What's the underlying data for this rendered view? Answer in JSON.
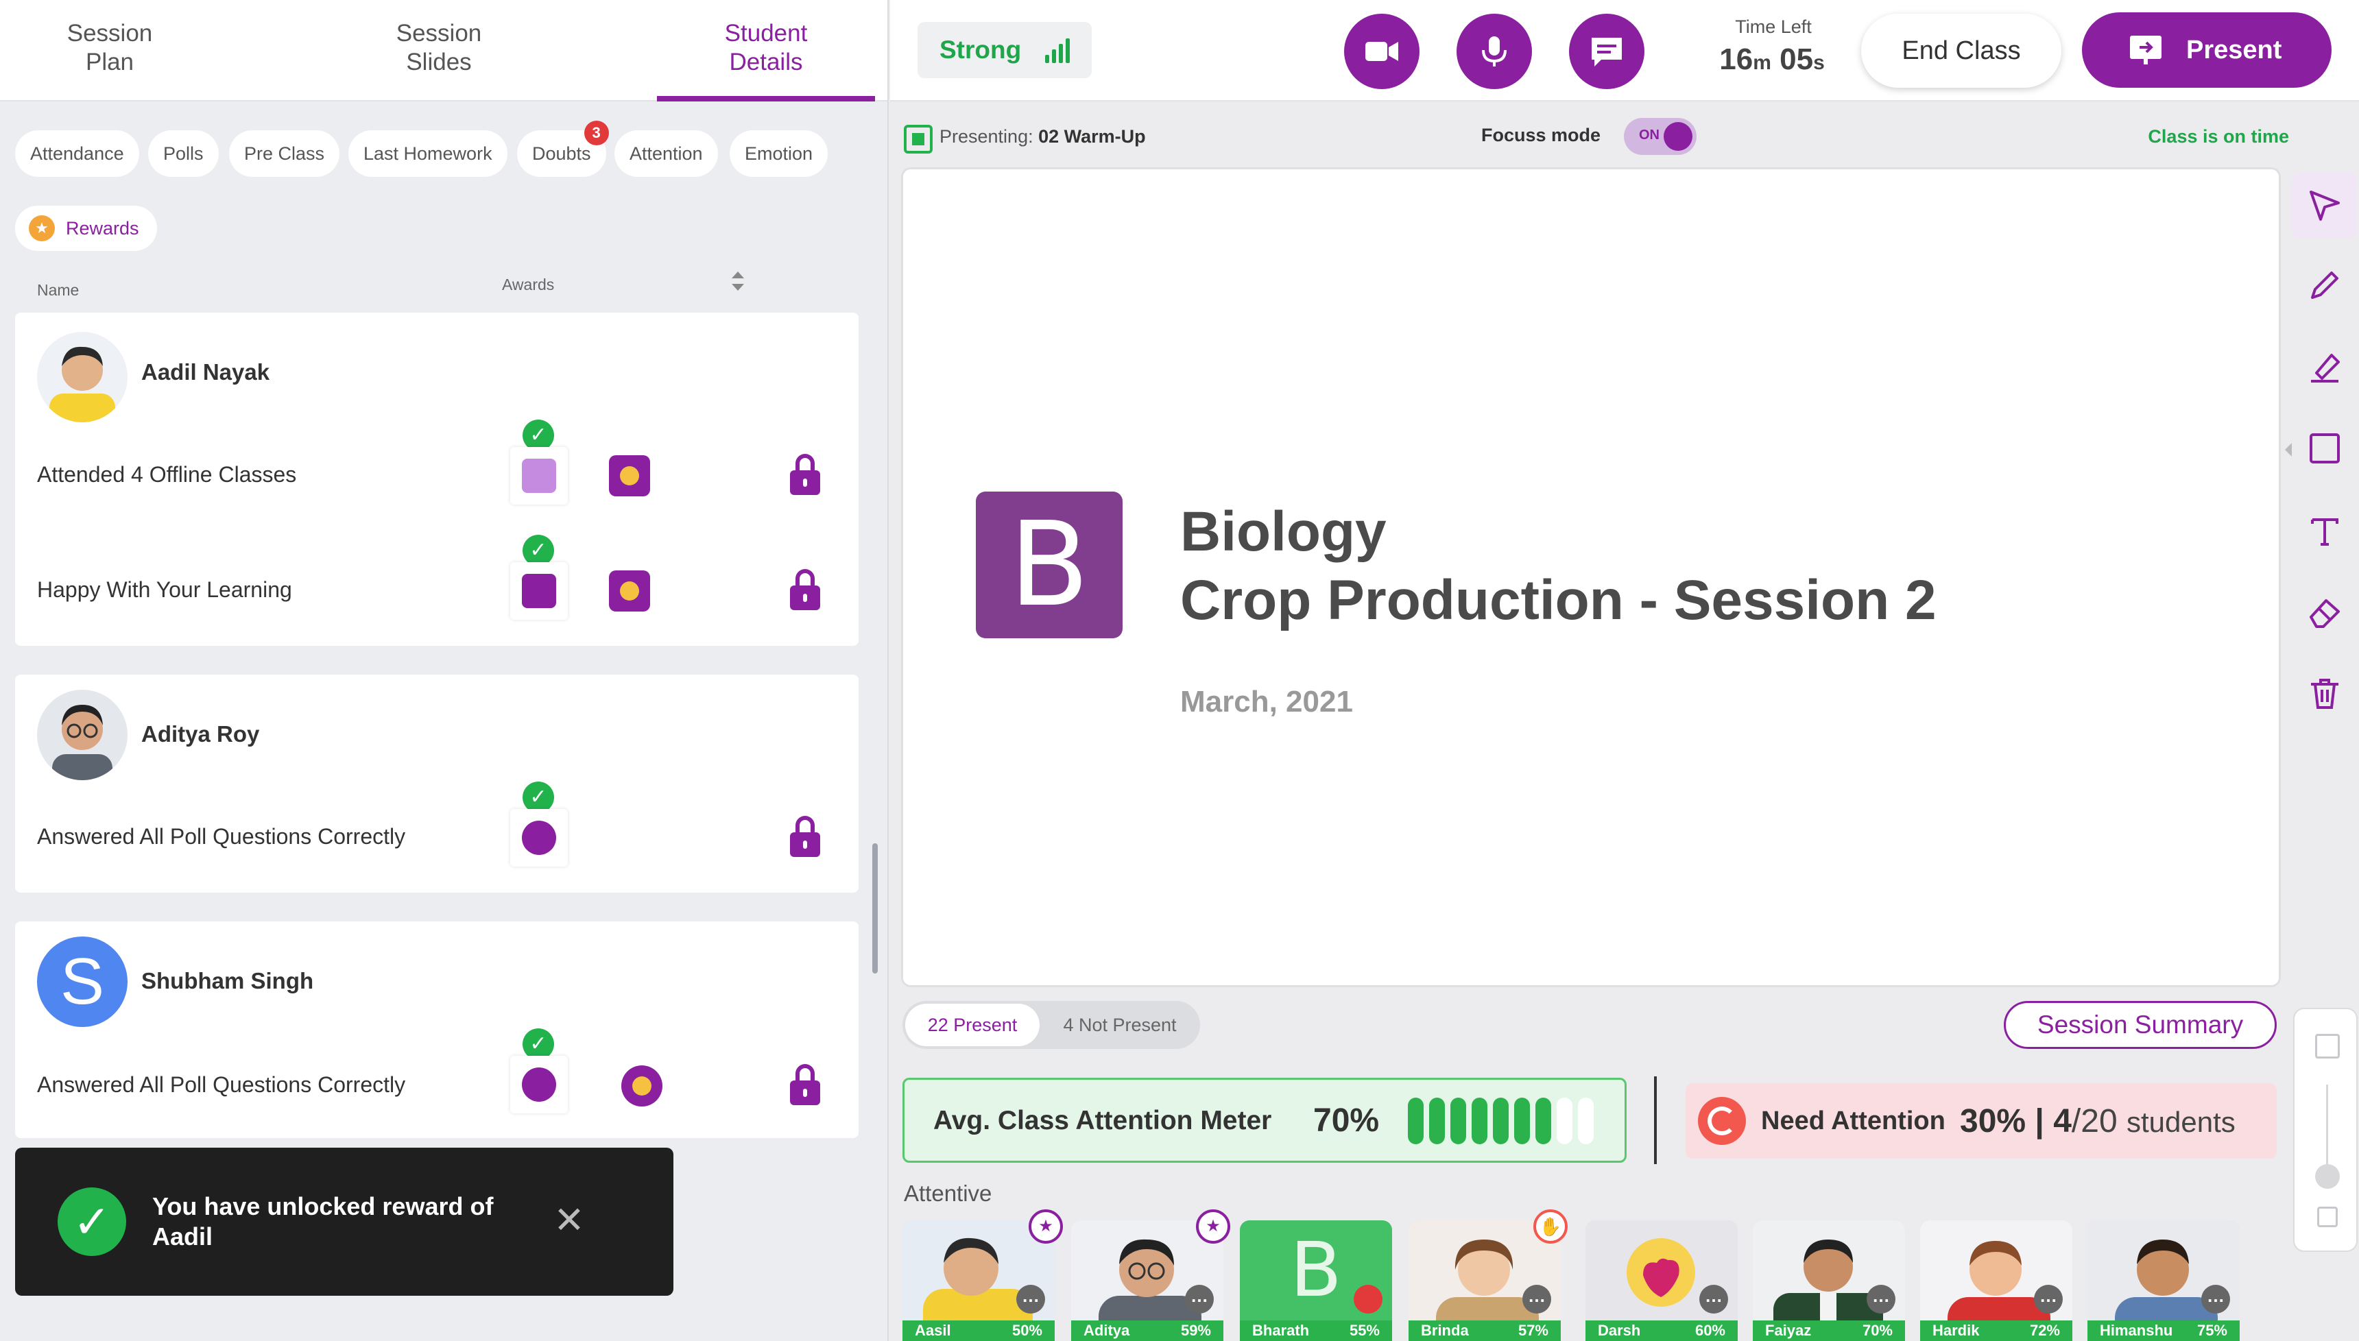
{
  "tabs": [
    {
      "label": "Session\nPlan"
    },
    {
      "label": "Session\nSlides"
    },
    {
      "label": "Student\nDetails",
      "active": true
    }
  ],
  "filters": [
    "Attendance",
    "Polls",
    "Pre Class",
    "Last Homework",
    "Doubts",
    "Attention",
    "Emotion"
  ],
  "doubts_badge": "3",
  "rewards_label": "Rewards",
  "columns": {
    "name": "Name",
    "awards": "Awards"
  },
  "students": [
    {
      "name": "Aadil Nayak",
      "awards": [
        "Attended 4 Offline Classes",
        "Happy With Your Learning"
      ]
    },
    {
      "name": "Aditya Roy",
      "awards": [
        "Answered All Poll Questions Correctly"
      ]
    },
    {
      "name": "Shubham Singh",
      "initial": "S",
      "awards": [
        "Answered All Poll Questions Correctly"
      ]
    }
  ],
  "toast": {
    "message": "You have unlocked reward of Aadil"
  },
  "topbar": {
    "network": "Strong",
    "time_left_label": "Time Left",
    "time_left_minutes": "16",
    "time_left_minutes_unit": "m",
    "time_left_seconds": "05",
    "time_left_seconds_unit": "s",
    "end_class": "End Class",
    "present": "Present"
  },
  "status": {
    "presenting_label": "Presenting:",
    "presenting_value": "02 Warm-Up",
    "focus_label": "Focuss mode",
    "focus_state": "ON",
    "class_status": "Class is on time"
  },
  "slide": {
    "logo_letter": "B",
    "subject": "Biology",
    "title": "Crop Production - Session 2",
    "date": "March, 2021"
  },
  "attendance": {
    "present": "22 Present",
    "not_present": "4 Not Present",
    "session_summary": "Session Summary"
  },
  "meter": {
    "label": "Avg. Class Attention Meter",
    "value": "70%",
    "filled_bars": 7,
    "total_bars": 9,
    "colors": {
      "filled": "#2bb24c",
      "empty": "#ffffff"
    }
  },
  "need_attention": {
    "label": "Need Attention",
    "percent": "30%",
    "sep": "|",
    "count": "4",
    "total": "/20",
    "unit": "students"
  },
  "attentive_label": "Attentive",
  "participants": [
    {
      "name": "Aasil",
      "pct": "50%"
    },
    {
      "name": "Aditya",
      "pct": "59%"
    },
    {
      "name": "Bharath",
      "pct": "55%",
      "initial": "B"
    },
    {
      "name": "Brinda",
      "pct": "57%"
    },
    {
      "name": "Darsh",
      "pct": "60%"
    },
    {
      "name": "Faiyaz",
      "pct": "70%"
    },
    {
      "name": "Hardik",
      "pct": "72%"
    },
    {
      "name": "Himanshu",
      "pct": "75%"
    }
  ],
  "accent": "#8a1fa0"
}
